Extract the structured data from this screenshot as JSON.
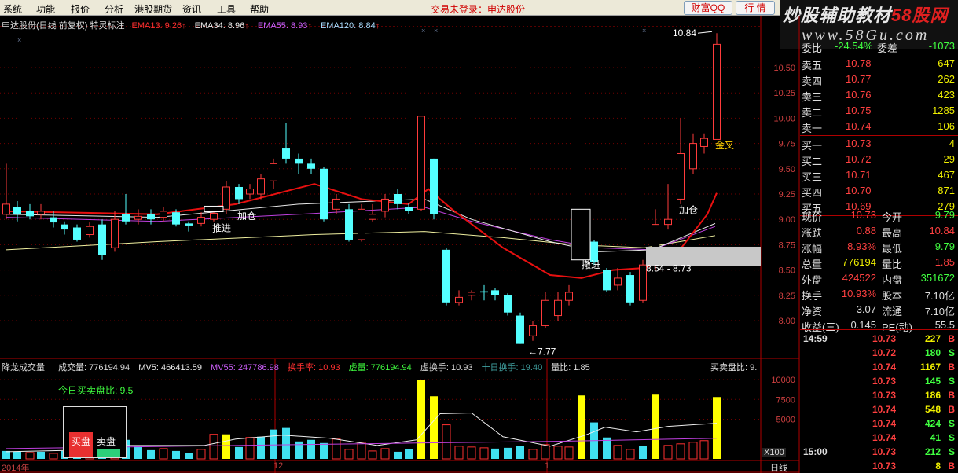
{
  "menu": {
    "items": [
      "系统",
      "功能",
      "报价",
      "分析",
      "港股期货",
      "资讯",
      "工具",
      "帮助"
    ],
    "status": "交易未登录：申达股份",
    "btn_wealth": "财富QQ",
    "btn_quote": "行 情"
  },
  "brand": {
    "title_a": "炒股辅助教材",
    "title_b": "58股网",
    "site": "www.58Gu.com"
  },
  "header": {
    "title": "申达股份(日线 前复权) 特灵标注",
    "ema13": "EMA13: 9.26",
    "ema34": "EMA34: 8.96",
    "ema55": "EMA55: 8.93",
    "ema120": "EMA120: 8.84",
    "arrow": "↑"
  },
  "price_axis": [
    "10.50",
    "10.25",
    "10.00",
    "9.75",
    "9.50",
    "9.25",
    "9.00",
    "8.75",
    "8.50",
    "8.25",
    "8.00"
  ],
  "annotations": {
    "high": "10.84",
    "low": "7.77",
    "jincha": "金叉",
    "jiacang1": "加仓",
    "jiacang2": "加仓",
    "tuijin": "推进",
    "shuaijin": "撤进",
    "range": "8.54 - 8.73"
  },
  "volume": {
    "title": "降龙成交量",
    "vol": "成交量: 776194.94",
    "mv5": "MV5: 466413.59",
    "mv55": "MV55: 247786.98",
    "turnover": "换手率: 10.93",
    "xvol": "虚量: 776194.94",
    "xturnover": "虚换手: 10.93",
    "turnover10": "十日换手: 19.40",
    "volratio": "量比: 1.85",
    "buysell": "买卖盘比: 9.",
    "today_ratio": "今日买卖盘比: 9.5",
    "buy_label": "买盘",
    "sell_label": "卖盘",
    "axis": [
      "10000",
      "7500",
      "5000"
    ],
    "unit": "X100"
  },
  "bottom": {
    "year": "2014年",
    "m12": "12",
    "m1": "1",
    "period": "日线"
  },
  "quote": {
    "wb_label": "委比",
    "wb_value": "-24.54%",
    "wc_label": "委差",
    "wc_value": "-1073",
    "asks": [
      {
        "label": "卖五",
        "price": "10.78",
        "vol": "647"
      },
      {
        "label": "卖四",
        "price": "10.77",
        "vol": "262"
      },
      {
        "label": "卖三",
        "price": "10.76",
        "vol": "423"
      },
      {
        "label": "卖二",
        "price": "10.75",
        "vol": "1285"
      },
      {
        "label": "卖一",
        "price": "10.74",
        "vol": "106"
      }
    ],
    "bids": [
      {
        "label": "买一",
        "price": "10.73",
        "vol": "4"
      },
      {
        "label": "买二",
        "price": "10.72",
        "vol": "29"
      },
      {
        "label": "买三",
        "price": "10.71",
        "vol": "467"
      },
      {
        "label": "买四",
        "price": "10.70",
        "vol": "871"
      },
      {
        "label": "买五",
        "price": "10.69",
        "vol": "279"
      }
    ],
    "stats": [
      {
        "l1": "现价",
        "v1": "10.73",
        "l2": "今开",
        "v2": "9.79"
      },
      {
        "l1": "涨跌",
        "v1": "0.88",
        "l2": "最高",
        "v2": "10.84"
      },
      {
        "l1": "涨幅",
        "v1": "8.93%",
        "l2": "最低",
        "v2": "9.79"
      },
      {
        "l1": "总量",
        "v1": "776194",
        "l2": "量比",
        "v2": "1.85"
      },
      {
        "l1": "外盘",
        "v1": "424522",
        "l2": "内盘",
        "v2": "351672"
      },
      {
        "l1": "换手",
        "v1": "10.93%",
        "l2": "股本",
        "v2": "7.10亿"
      },
      {
        "l1": "净资",
        "v1": "3.07",
        "l2": "流通",
        "v2": "7.10亿"
      },
      {
        "l1": "收益(三)",
        "v1": "0.145",
        "l2": "PE(动)",
        "v2": "55.5"
      }
    ]
  },
  "ticks": [
    {
      "time": "14:59",
      "price": "10.73",
      "vol": "227",
      "dir": "B"
    },
    {
      "time": "",
      "price": "10.72",
      "vol": "180",
      "dir": "S"
    },
    {
      "time": "",
      "price": "10.74",
      "vol": "1167",
      "dir": "B"
    },
    {
      "time": "",
      "price": "10.73",
      "vol": "145",
      "dir": "S"
    },
    {
      "time": "",
      "price": "10.73",
      "vol": "186",
      "dir": "B"
    },
    {
      "time": "",
      "price": "10.74",
      "vol": "548",
      "dir": "B"
    },
    {
      "time": "",
      "price": "10.74",
      "vol": "424",
      "dir": "S"
    },
    {
      "time": "",
      "price": "10.74",
      "vol": "41",
      "dir": "S"
    },
    {
      "time": "15:00",
      "price": "10.73",
      "vol": "212",
      "dir": "S"
    },
    {
      "time": "",
      "price": "10.73",
      "vol": "8",
      "dir": "B"
    }
  ],
  "colors": {
    "up": "#ff3b3b",
    "down": "#54ffff",
    "ema13": "#e81010",
    "ema34": "#e8e8e8",
    "ema55": "#c040e0",
    "ema120": "#f0f0a0",
    "vol_yellow": "#ffff00",
    "axis_red": "#b00000"
  }
}
